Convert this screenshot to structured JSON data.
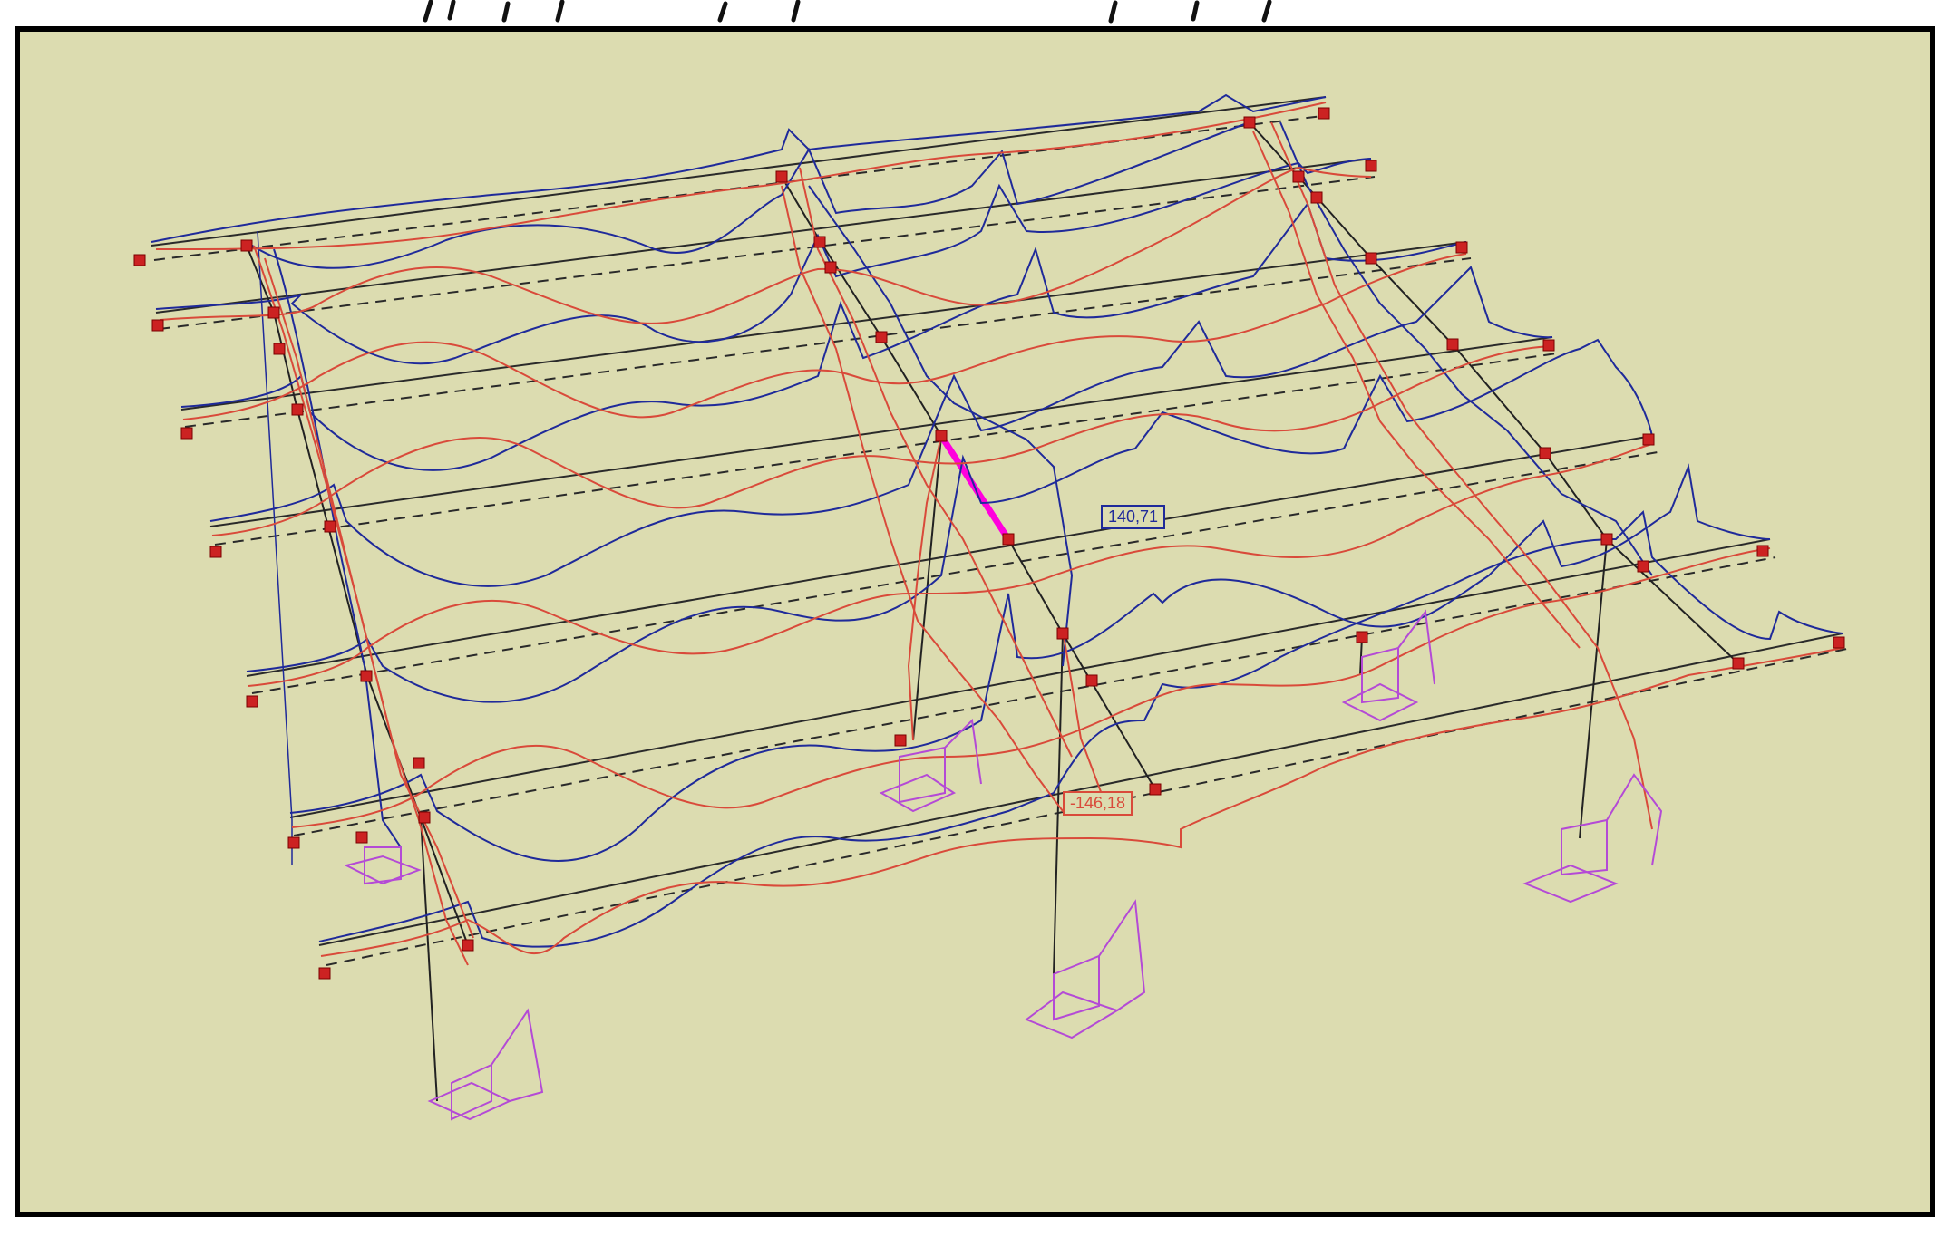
{
  "labels": {
    "max_value": "140,71",
    "min_value": "-146,18"
  },
  "colors": {
    "background": "#dcdcb0",
    "frame_line": "#000000",
    "moment_blue": "#1f2a9a",
    "moment_red": "#d94a3a",
    "support": "#b44ad6",
    "node": "#cc2222",
    "selected_member": "#ff00dd"
  },
  "icons": [
    "node-square-icon",
    "support-symbol-icon"
  ]
}
